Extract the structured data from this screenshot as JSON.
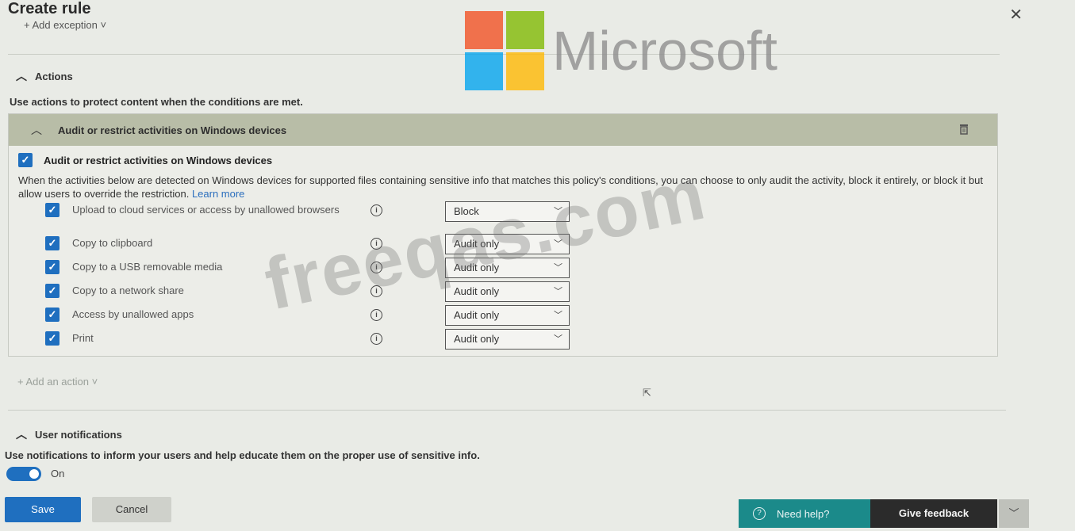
{
  "header": {
    "title": "Create rule",
    "add_exception": "+ Add exception ˅",
    "close_glyph": "✕"
  },
  "watermark": {
    "brand": "Microsoft",
    "logo_colors": [
      "#f25022",
      "#7fba00",
      "#00a4ef",
      "#ffb900"
    ],
    "site": "freeqas.com"
  },
  "actions_section": {
    "heading": "Actions",
    "description": "Use actions to protect content when the conditions are met.",
    "panel_title": "Audit or restrict activities on Windows devices",
    "main_checkbox_label": "Audit or restrict activities on Windows devices",
    "main_checked": true,
    "paragraph": "When the activities below are detected on Windows devices for supported files containing sensitive info that matches this policy's conditions, you can choose to only audit the activity, block it entirely, or block it but allow users to override the restriction.",
    "learn_more": "Learn more",
    "activities": [
      {
        "label": "Upload to cloud services or access by unallowed browsers",
        "checked": true,
        "value": "Block"
      },
      {
        "label": "Copy to clipboard",
        "checked": true,
        "value": "Audit only"
      },
      {
        "label": "Copy to a USB removable media",
        "checked": true,
        "value": "Audit only"
      },
      {
        "label": "Copy to a network share",
        "checked": true,
        "value": "Audit only"
      },
      {
        "label": "Access by unallowed apps",
        "checked": true,
        "value": "Audit only"
      },
      {
        "label": "Print",
        "checked": true,
        "value": "Audit only"
      }
    ],
    "add_action": "+ Add an action ˅"
  },
  "notifications_section": {
    "heading": "User notifications",
    "description": "Use notifications to inform your users and help educate them on the proper use of sensitive info.",
    "toggle_state": "On"
  },
  "footer": {
    "save": "Save",
    "cancel": "Cancel",
    "need_help": "Need help?",
    "give_feedback": "Give feedback"
  },
  "colors": {
    "accent": "#1f6fbf",
    "help_teal": "#1b8a8a",
    "panel_header": "#b8bda7"
  }
}
